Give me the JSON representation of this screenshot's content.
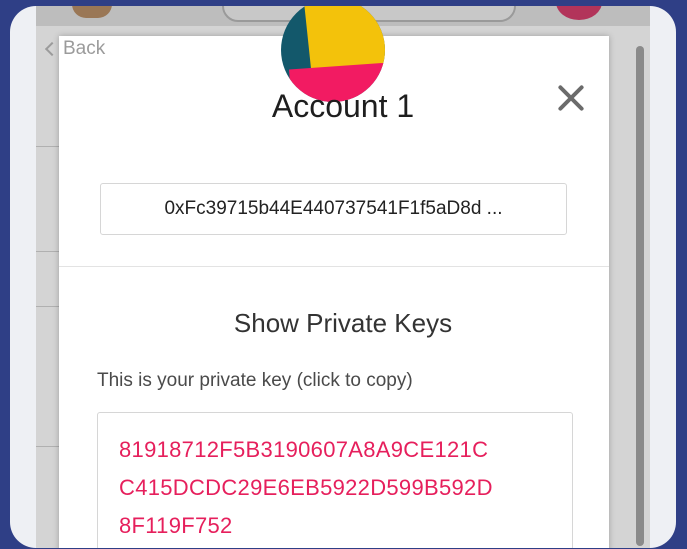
{
  "modal": {
    "back_label": "Back",
    "account_name": "Account 1",
    "address": "0xFc39715b44E440737541F1f5aD8d ..."
  },
  "private_keys": {
    "section_title": "Show Private Keys",
    "instruction": "This is your private key (click to copy)",
    "key_lines": [
      "81918712F5B3190607A8A9CE121C",
      "C415DCDC29E6EB5922D599B592D",
      "8F119F752"
    ]
  },
  "icons": {
    "back": "chevron-left-icon",
    "close": "close-icon",
    "identicon": "account-identicon"
  },
  "colors": {
    "page_background": "#2f3f86",
    "private_key_text": "#e61f5c",
    "identicon_teal": "#13586b",
    "identicon_yellow": "#f3c20b",
    "identicon_pink": "#f21b62"
  }
}
